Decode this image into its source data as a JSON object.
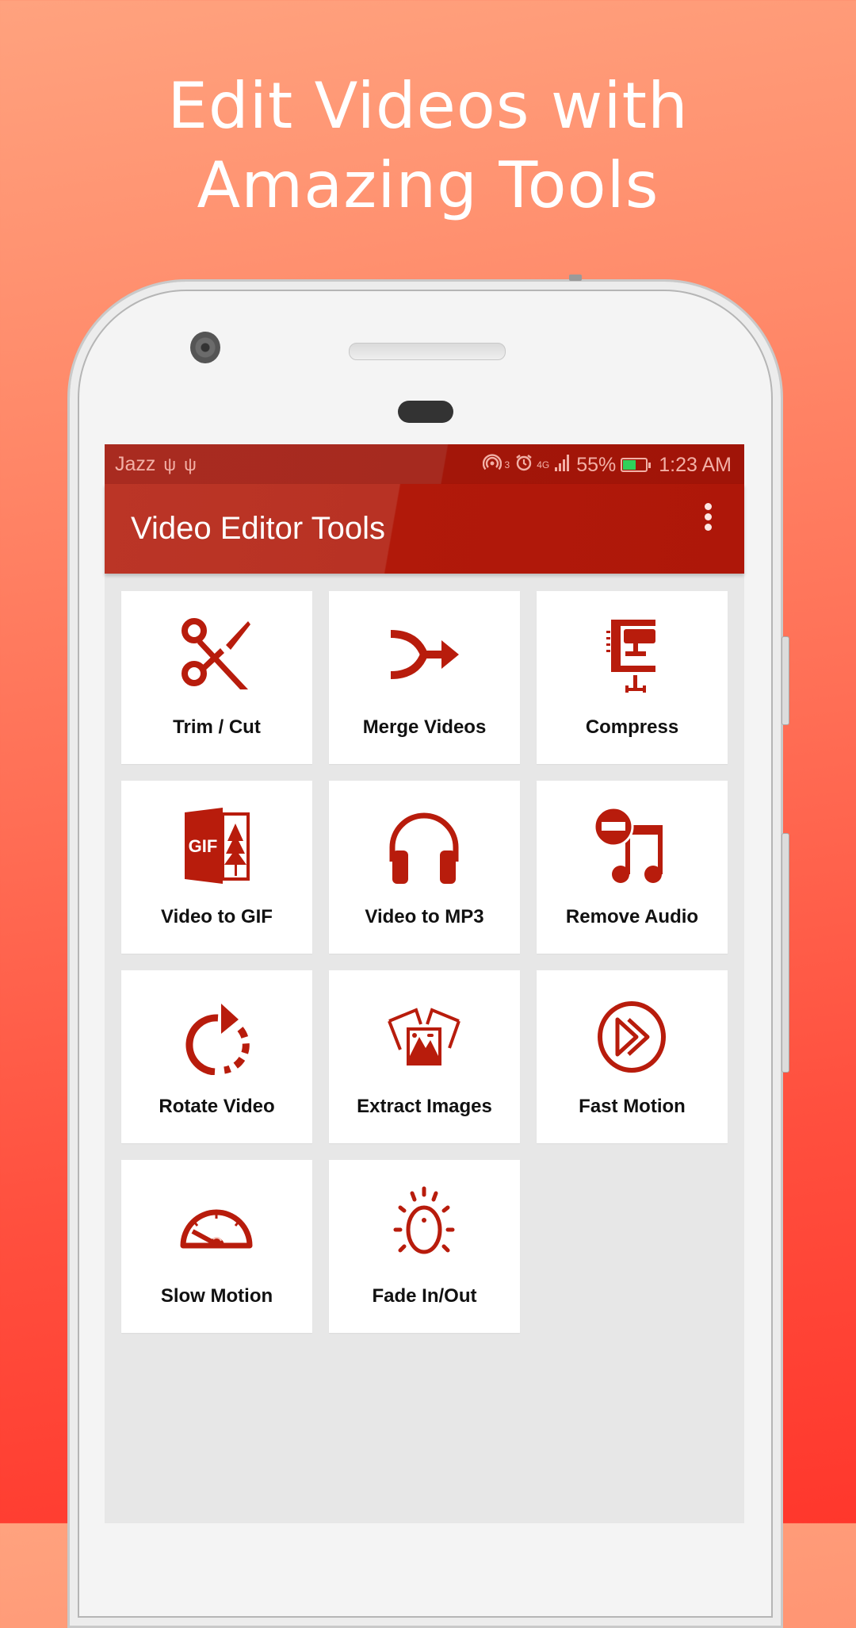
{
  "promo": {
    "headline_line1": "Edit Videos with",
    "headline_line2": "Amazing Tools"
  },
  "status_bar": {
    "carrier": "Jazz",
    "left_icons": [
      "usb-icon",
      "usb-icon"
    ],
    "right_icons": [
      "hotspot-icon",
      "alarm-icon",
      "signal-4g-icon",
      "battery-charging-icon"
    ],
    "hotspot_count": "3",
    "network_type": "4G",
    "battery_percent": "55%",
    "battery_level": 0.55,
    "time": "1:23 AM"
  },
  "app_bar": {
    "title": "Video Editor Tools",
    "menu_icon": "more-vert-icon"
  },
  "colors": {
    "primary": "#b1190a",
    "icon": "#b81c0c",
    "background": "#e7e7e7",
    "battery_fill": "#2fd05a"
  },
  "tools": [
    {
      "label": "Trim / Cut",
      "icon": "scissors-icon"
    },
    {
      "label": "Merge Videos",
      "icon": "merge-arrow-icon"
    },
    {
      "label": "Compress",
      "icon": "clamp-icon"
    },
    {
      "label": "Video to GIF",
      "icon": "gif-icon"
    },
    {
      "label": "Video to MP3",
      "icon": "headphones-icon"
    },
    {
      "label": "Remove Audio",
      "icon": "music-note-remove-icon"
    },
    {
      "label": "Rotate Video",
      "icon": "rotate-icon"
    },
    {
      "label": "Extract Images",
      "icon": "images-icon"
    },
    {
      "label": "Fast Motion",
      "icon": "fast-forward-icon"
    },
    {
      "label": "Slow Motion",
      "icon": "speedometer-icon"
    },
    {
      "label": "Fade In/Out",
      "icon": "brightness-icon"
    }
  ]
}
